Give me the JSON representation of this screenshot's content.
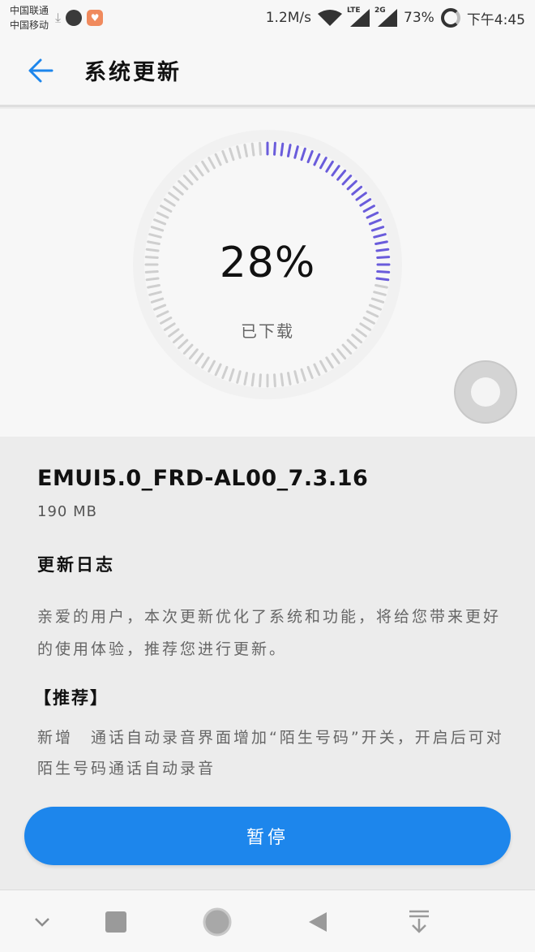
{
  "status_bar": {
    "carrier_1": "中国联通",
    "carrier_2": "中国移动",
    "speed": "1.2M/s",
    "network_lte": "LTE",
    "network_2g": "2G",
    "battery": "73%",
    "time": "下午4:45"
  },
  "toolbar": {
    "title": "系统更新",
    "back_icon": "arrow-left-icon"
  },
  "progress": {
    "percent_text": "28%",
    "value": 0.28,
    "label": "已下载",
    "accent_color": "#6a5cdb",
    "track_color": "#cfcfcf"
  },
  "package": {
    "version": "EMUI5.0_FRD-AL00_7.3.16",
    "size": "190 MB"
  },
  "changelog": {
    "title": "更新日志",
    "body": "亲爱的用户，本次更新优化了系统和功能，将给您带来更好的使用体验，推荐您进行更新。",
    "recommend_title": "【推荐】",
    "recommend_body": "新增　通话自动录音界面增加“陌生号码”开关，开启后可对陌生号码通话自动录音"
  },
  "actions": {
    "pause_label": "暂停",
    "pause_color": "#1d86ec"
  },
  "nav": {
    "icons": [
      "chevron-down-icon",
      "square-icon",
      "home-circle-icon",
      "back-triangle-icon",
      "notification-drawer-icon"
    ]
  }
}
